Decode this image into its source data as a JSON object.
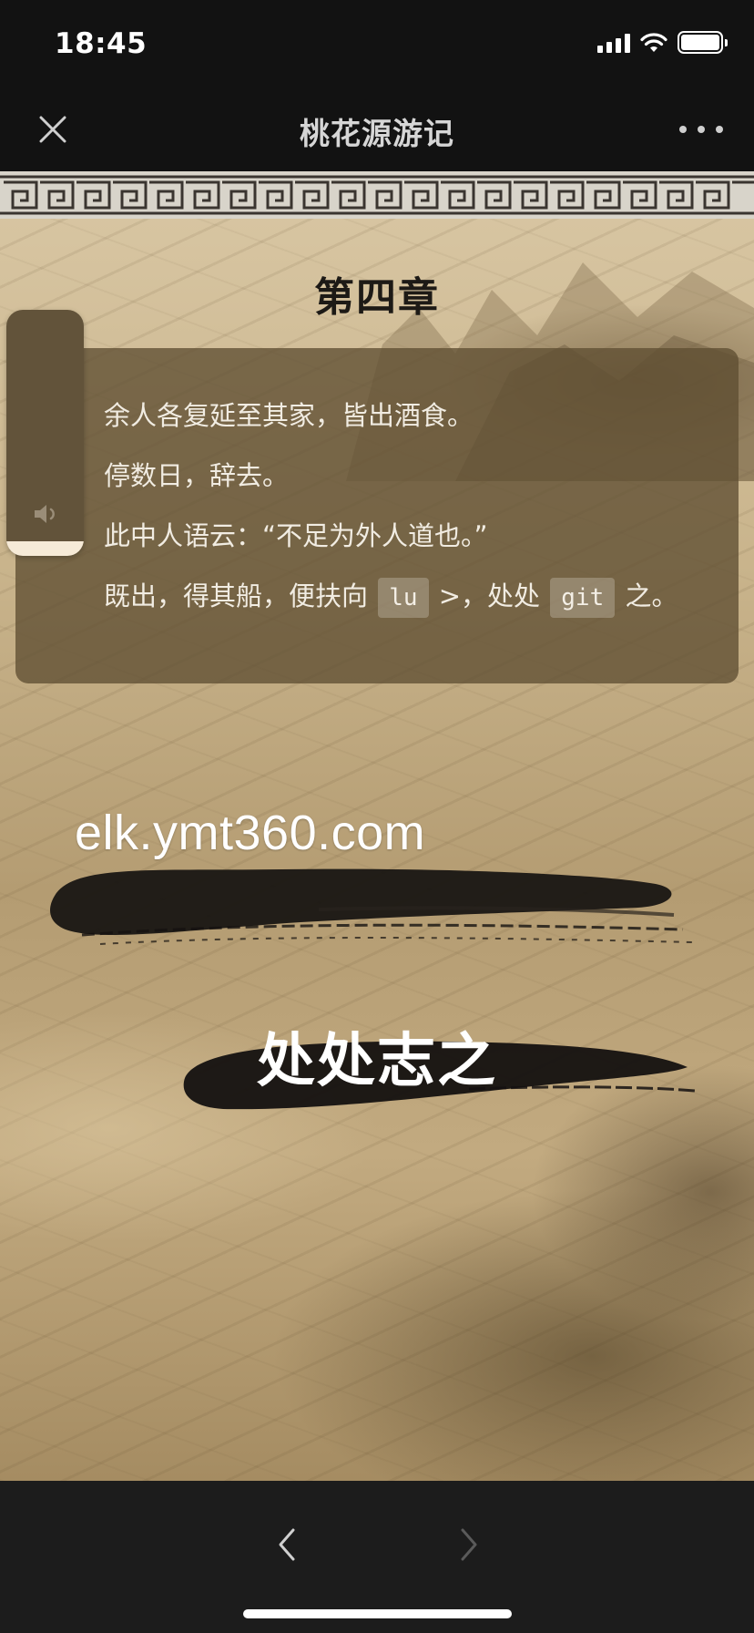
{
  "status_bar": {
    "time": "18:45",
    "icons": [
      "signal-icon",
      "wifi-icon",
      "battery-icon"
    ]
  },
  "nav": {
    "title": "桃花源游记",
    "close_icon": "close-icon",
    "more_icon": "more-icon"
  },
  "chapter": {
    "title": "第四章",
    "lines": [
      {
        "text": "余人各复延至其家，皆出酒食。"
      },
      {
        "text": "停数日，辞去。"
      },
      {
        "text": "此中人语云：“不足为外人道也。”"
      },
      {
        "part1": "既出，得其船，便扶向 ",
        "code1": "lu",
        "part2": " >，处处 ",
        "code2": "git",
        "part3": " 之。"
      }
    ]
  },
  "audio": {
    "icon": "volume-icon",
    "level": 0.06
  },
  "overlay": {
    "url": "elk.ymt360.com",
    "slogan": "处处志之"
  },
  "bottom_bar": {
    "back_icon": "chevron-left-icon",
    "forward_icon": "chevron-right-icon",
    "forward_enabled": false
  },
  "colors": {
    "accent_card": "#5f4e32",
    "slider_fill": "#f6ead7",
    "bar_background": "#121212"
  }
}
